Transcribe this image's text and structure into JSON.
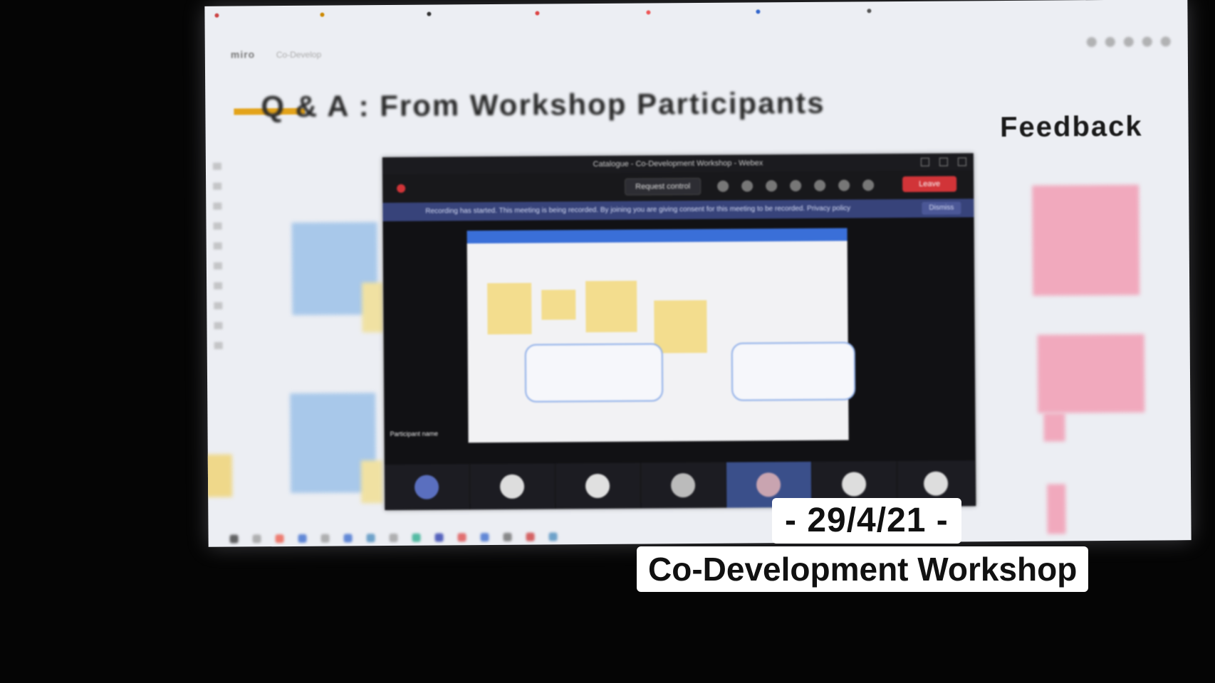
{
  "board": {
    "app_name": "miro",
    "board_name": "Co-Develop",
    "qa_title": "Q & A : From Workshop Participants",
    "feedback_title": "Feedback"
  },
  "teams_window": {
    "title": "Catalogue - Co-Development Workshop - Webex",
    "request_control_label": "Request control",
    "leave_label": "Leave",
    "notification_text": "Recording has started. This meeting is being recorded. By joining you are giving consent for this meeting to be recorded. Privacy policy",
    "dismiss_label": "Dismiss",
    "participant_name": "Participant name"
  },
  "overlay": {
    "date": "- 29/4/21 -",
    "event": "Co-Development Workshop"
  },
  "colors": {
    "sticky_blue": "#a8c8ea",
    "sticky_pink": "#f1a9bd",
    "sticky_yellow": "#f3dd8e",
    "leave_red": "#d13438",
    "title_accent": "#e3a31a"
  }
}
